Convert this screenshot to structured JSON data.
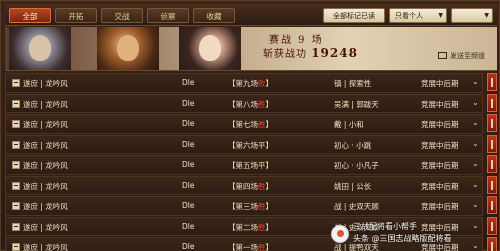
{
  "tabs": [
    {
      "label": "全部",
      "active": true
    },
    {
      "label": "开拓",
      "active": false
    },
    {
      "label": "交战",
      "active": false
    },
    {
      "label": "侦察",
      "active": false
    },
    {
      "label": "收藏",
      "active": false
    }
  ],
  "toolbar": {
    "mark_all_read": "全部标记已读",
    "filter_value": "只看个人"
  },
  "banner": {
    "season": "赛战 9 场",
    "kills_label": "斩获战功",
    "kills_value": "19248",
    "resend_label": "发送至频道"
  },
  "colors": {
    "win": "#e04a2a",
    "lose": "#7ec44a",
    "tie": "#e8d08a",
    "accent": "#b8451f"
  },
  "rows": [
    {
      "sender": "遂庶 | 龙吟风",
      "opponent": "Dle",
      "round": "【第九场",
      "result": "败",
      "result_type": "win",
      "players": "镇 | 探索性",
      "stage": "竞展中后期"
    },
    {
      "sender": "遂庶 | 龙吟风",
      "opponent": "Dle",
      "round": "【第八场",
      "result": "胜",
      "result_type": "win",
      "players": "吴满 | 郭跋天",
      "stage": "竞展中后期"
    },
    {
      "sender": "遂庶 | 龙吟风",
      "opponent": "Dle",
      "round": "【第七场",
      "result": "胜",
      "result_type": "win",
      "players": "戴 | 小和",
      "stage": "竞展中后期"
    },
    {
      "sender": "遂庶 | 龙吟风",
      "opponent": "Dle",
      "round": "【第六场",
      "result": "平",
      "result_type": "tie",
      "players": "初心 · 小跳",
      "stage": "竞展中后期"
    },
    {
      "sender": "遂庶 | 龙吟风",
      "opponent": "Dle",
      "round": "【第五场",
      "result": "平",
      "result_type": "tie",
      "players": "初心 · 小凡子",
      "stage": "竞展中后期"
    },
    {
      "sender": "遂庶 | 龙吟风",
      "opponent": "Dle",
      "round": "【第四场",
      "result": "胜",
      "result_type": "win",
      "players": "姚田 | 公长",
      "stage": "竞展中后期"
    },
    {
      "sender": "遂庶 | 龙吟风",
      "opponent": "Dle",
      "round": "【第三场",
      "result": "胜",
      "result_type": "win",
      "players": "战 | 史双天顾",
      "stage": "竞展中后期"
    },
    {
      "sender": "遂庶 | 龙吟风",
      "opponent": "Dle",
      "round": "【第二场",
      "result": "胜",
      "result_type": "win",
      "players": "战 | 史双天顾",
      "stage": "竞展中后期"
    },
    {
      "sender": "遂庶 | 龙吟风",
      "opponent": "Dle",
      "round": "【第一场",
      "result": "胜",
      "result_type": "win",
      "players": "战 | 提鸭双天",
      "stage": "竞展中后期"
    }
  ],
  "watermark": {
    "line1": "三战配将看小帮手",
    "line2": "头条 @三国志战略版配将看"
  }
}
